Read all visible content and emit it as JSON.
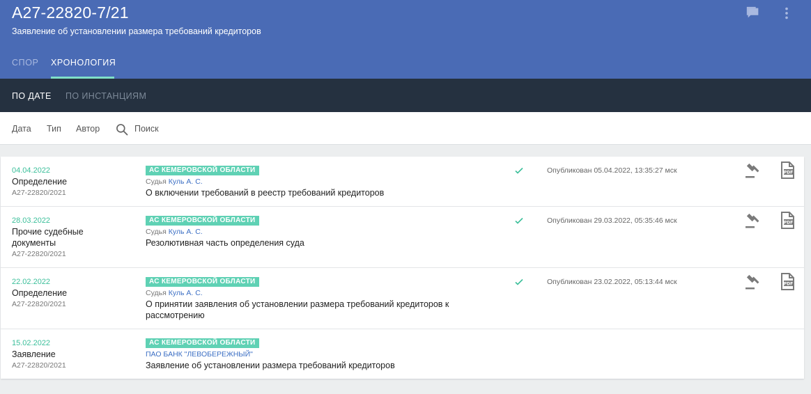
{
  "header": {
    "case_number": "А27-22820-7/21",
    "subtitle": "Заявление об установлении размера требований кредиторов",
    "tabs": [
      "СПОР",
      "ХРОНОЛОГИЯ"
    ],
    "active_tab": "ХРОНОЛОГИЯ",
    "icons": [
      "chat-icon",
      "more-vert-icon"
    ]
  },
  "subnav": {
    "tabs": [
      "ПО ДАТЕ",
      "ПО ИНСТАНЦИЯМ"
    ],
    "active_tab": "ПО ДАТЕ"
  },
  "filters": {
    "date": "Дата",
    "type": "Тип",
    "author": "Автор",
    "search": "Поиск"
  },
  "colors": {
    "header_bg": "#4a6bb5",
    "subnav_bg": "#253140",
    "accent": "#5fd1b4",
    "link": "#3c6fc4"
  },
  "events": [
    {
      "date": "04.04.2022",
      "type": "Определение",
      "case": "А27-22820/2021",
      "court": "АС КЕМЕРОВСКОЙ ОБЛАСТИ",
      "judge_prefix": "Судья",
      "judge": "Куль А. С.",
      "title": "О включении требований в реестр требований кредиторов",
      "published": "Опубликован 05.04.2022, 13:35:27 мск"
    },
    {
      "date": "28.03.2022",
      "type": "Прочие судебные документы",
      "case": "А27-22820/2021",
      "court": "АС КЕМЕРОВСКОЙ ОБЛАСТИ",
      "judge_prefix": "Судья",
      "judge": "Куль А. С.",
      "title": "Резолютивная часть определения суда",
      "published": "Опубликован 29.03.2022, 05:35:46 мск"
    },
    {
      "date": "22.02.2022",
      "type": "Определение",
      "case": "А27-22820/2021",
      "court": "АС КЕМЕРОВСКОЙ ОБЛАСТИ",
      "judge_prefix": "Судья",
      "judge": "Куль А. С.",
      "title": "О принятии заявления об установлении размера требований кредиторов к рассмотрению",
      "published": "Опубликован 23.02.2022, 05:13:44 мск"
    },
    {
      "date": "15.02.2022",
      "type": "Заявление",
      "case": "А27-22820/2021",
      "court": "АС КЕМЕРОВСКОЙ ОБЛАСТИ",
      "author": "ПАО БАНК \"ЛЕВОБЕРЕЖНЫЙ\"",
      "title": "Заявление об установлении размера требований кредиторов"
    }
  ]
}
